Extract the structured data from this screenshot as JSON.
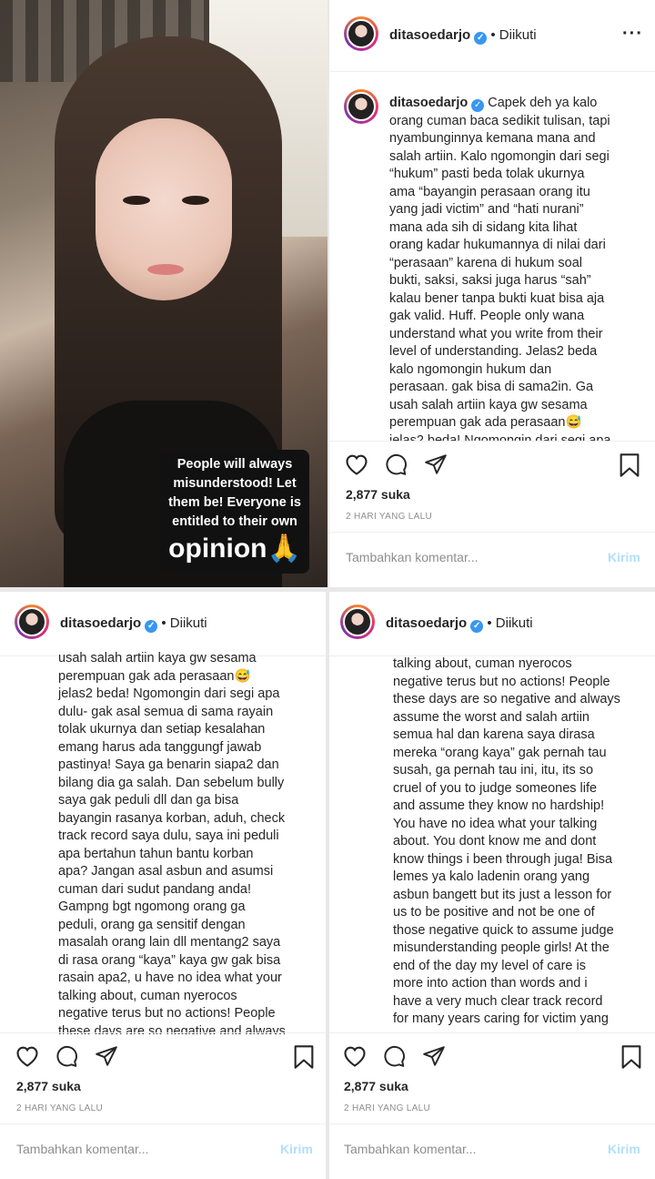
{
  "photo": {
    "sticker_lines": "People will always\nmisunderstood! Let\nthem be! Everyone is\nentitled to their own",
    "sticker_big": "opinion🙏"
  },
  "post1": {
    "username": "ditasoedarjo",
    "follow": "• Diikuti",
    "more": "···",
    "caption_user": "ditasoedarjo",
    "caption": "Capek deh ya kalo\norang cuman baca sedikit tulisan, tapi\nnyambunginnya kemana mana and\nsalah artiin. Kalo ngomongin dari segi\n“hukum” pasti beda tolak ukurnya\nama “bayangin perasaan orang itu\nyang jadi victim” and “hati nurani”\nmana ada sih di sidang kita lihat\norang kadar hukumannya di nilai dari\n“perasaan” karena di hukum soal\nbukti, saksi, saksi juga harus “sah”\nkalau bener tanpa bukti kuat bisa aja\ngak valid. Huff. People only wana\nunderstand what you write from their\nlevel of understanding. Jelas2 beda\nkalo ngomongin hukum dan\nperasaan. gak bisa di sama2in. Ga\nusah salah artiin kaya gw sesama\nperempuan gak ada perasaan😅\njelas2 beda! Ngomongin dari segi apa",
    "likes": "2,877 suka",
    "time": "2 HARI YANG LALU",
    "comment_placeholder": "Tambahkan komentar...",
    "post_label": "Kirim"
  },
  "post2": {
    "username": "ditasoedarjo",
    "follow": "• Diikuti",
    "caption": "usah salah artiin kaya gw sesama\nperempuan gak ada perasaan😅\njelas2 beda! Ngomongin dari segi apa\ndulu- gak asal semua di sama rayain\ntolak ukurnya dan setiap kesalahan\nemang harus ada tanggungf jawab\npastinya! Saya ga benarin siapa2 dan\nbilang dia ga salah. Dan sebelum bully\nsaya gak peduli dll dan ga bisa\nbayangin rasanya korban, aduh, check\ntrack record saya dulu, saya ini peduli\napa bertahun tahun bantu korban\napa? Jangan asal asbun and asumsi\ncuman dari sudut pandang anda!\nGampng bgt ngomong orang ga\npeduli, orang ga sensitif dengan\nmasalah orang lain dll mentang2 saya\ndi rasa orang “kaya” kaya gw gak bisa\nrasain apa2, u have no idea what your\ntalking about, cuman nyerocos\nnegative terus but no actions! People\nthese days are so negative and always",
    "likes": "2,877 suka",
    "time": "2 HARI YANG LALU",
    "comment_placeholder": "Tambahkan komentar...",
    "post_label": "Kirim"
  },
  "post3": {
    "username": "ditasoedarjo",
    "follow": "• Diikuti",
    "caption": "talking about, cuman nyerocos\nnegative terus but no actions! People\nthese days are so negative and always\nassume the worst and salah artiin\nsemua hal dan karena saya dirasa\nmereka “orang kaya” gak pernah tau\nsusah, ga pernah tau ini, itu, its so\ncruel of you to judge someones life\nand assume they know no hardship!\nYou have no idea what your talking\nabout. You dont know me and dont\nknow things i been through juga! Bisa\nlemes ya kalo ladenin orang yang\nasbun bangett but its just a lesson for\nus to be positive and not be one of\nthose negative quick to assume judge\nmisunderstanding people girls! At the\nend of the day my level of care is\nmore into action than words and i\nhave a very much clear track record\nfor many years caring for victim yang",
    "likes": "2,877 suka",
    "time": "2 HARI YANG LALU",
    "comment_placeholder": "Tambahkan komentar...",
    "post_label": "Kirim"
  }
}
